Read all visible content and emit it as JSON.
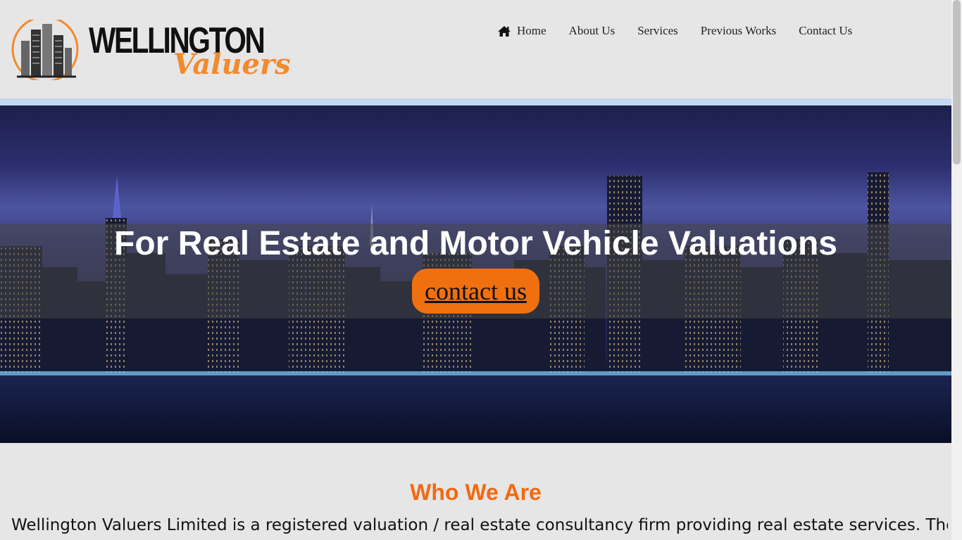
{
  "brand": {
    "name_line1": "WELLINGTON",
    "name_line2": "Valuers",
    "accent_color": "#f28a2e"
  },
  "nav": {
    "items": [
      {
        "label": "Home",
        "icon": "home-icon"
      },
      {
        "label": "About Us"
      },
      {
        "label": "Services"
      },
      {
        "label": "Previous Works"
      },
      {
        "label": "Contact Us"
      }
    ]
  },
  "hero": {
    "title": "For Real Estate and Motor Vehicle Valuations",
    "button_label": "contact us",
    "button_color": "#f07010"
  },
  "about": {
    "heading": "Who We Are",
    "heading_color": "#f26a12",
    "text": "Wellington Valuers Limited is a registered valuation / real estate consultancy firm providing real estate services. The firm"
  }
}
